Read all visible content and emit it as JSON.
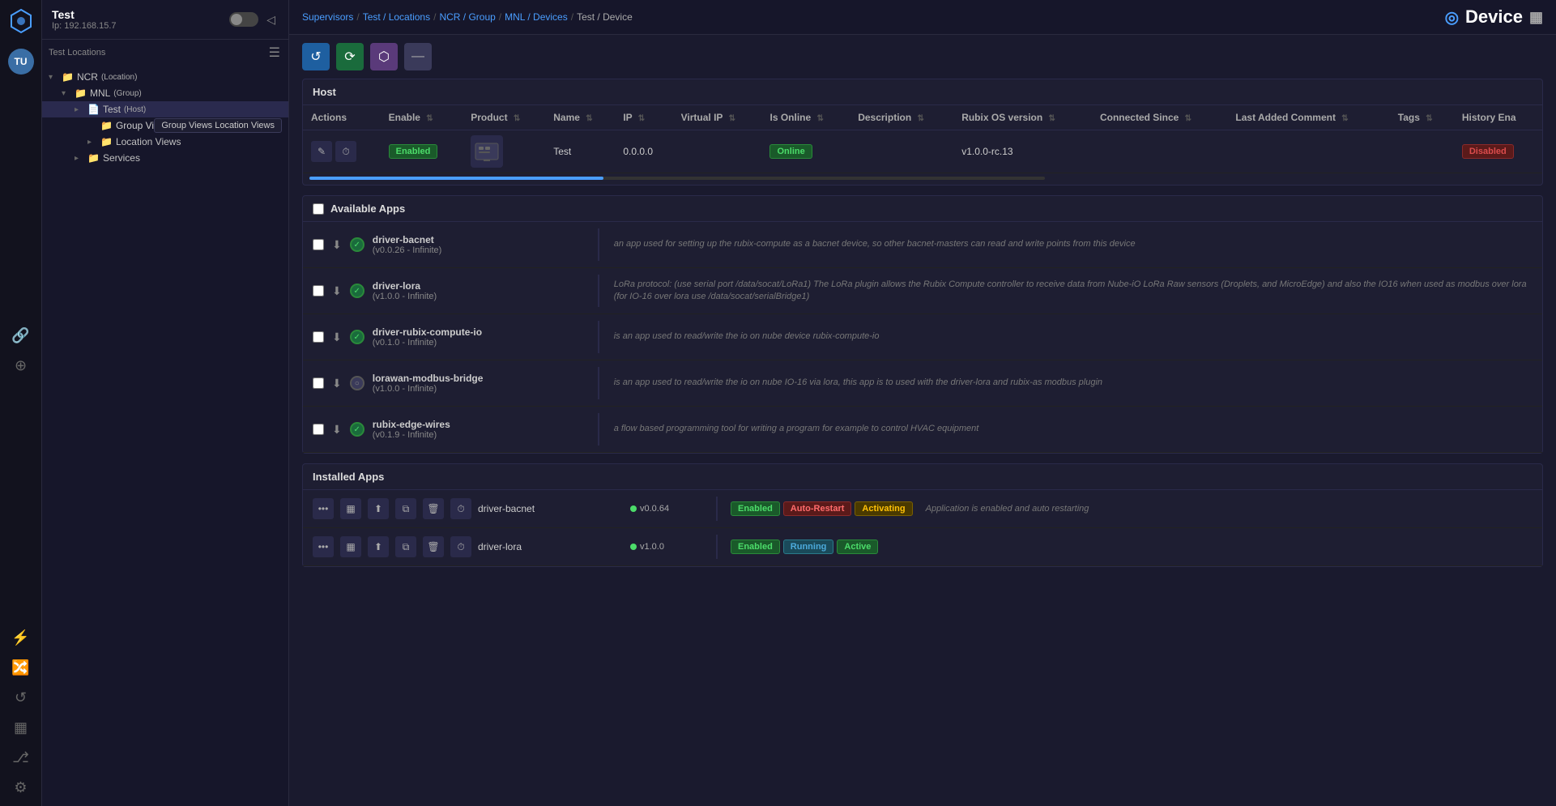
{
  "app": {
    "logo": "◈",
    "title": "Device"
  },
  "sidebar": {
    "host_name": "Test",
    "host_ip": "Ip: 192.168.15.7",
    "tree": [
      {
        "id": "ncr",
        "level": 1,
        "label": "NCR",
        "badge": "(Location)",
        "icon": "📁",
        "chevron": "▾",
        "expanded": true
      },
      {
        "id": "mnl",
        "level": 2,
        "label": "MNL",
        "badge": "(Group)",
        "icon": "📁",
        "chevron": "▾",
        "expanded": true
      },
      {
        "id": "test-host",
        "level": 3,
        "label": "Test",
        "badge": "(Host)",
        "icon": "📄",
        "chevron": "▸",
        "selected": true
      },
      {
        "id": "group-views",
        "level": 4,
        "label": "Group Views",
        "badge": "",
        "icon": "📁",
        "chevron": ""
      },
      {
        "id": "location-views",
        "level": 4,
        "label": "Location Views",
        "badge": "",
        "icon": "📁",
        "chevron": "▸"
      },
      {
        "id": "services",
        "level": 3,
        "label": "Services",
        "badge": "",
        "icon": "📁",
        "chevron": "▸"
      }
    ],
    "nav_icons": [
      "⚡",
      "🔗",
      "⊕",
      "⚙"
    ]
  },
  "breadcrumb": {
    "items": [
      "Supervisors",
      "Test / Locations",
      "NCR / Group",
      "MNL / Devices",
      "Test / Device"
    ],
    "separators": [
      "/",
      "/",
      "/",
      "/"
    ]
  },
  "topbar": {
    "page_title": "Device"
  },
  "toolbar": {
    "buttons": [
      {
        "id": "refresh",
        "icon": "↺",
        "color": "blue",
        "label": "Refresh"
      },
      {
        "id": "sync",
        "icon": "⟳",
        "color": "green",
        "label": "Sync"
      },
      {
        "id": "settings",
        "icon": "⬡",
        "color": "purple",
        "label": "Settings"
      },
      {
        "id": "more",
        "icon": "⊟",
        "color": "gray",
        "label": "More"
      }
    ]
  },
  "host_section": {
    "title": "Host",
    "columns": [
      "Actions",
      "Enable",
      "Product",
      "Name",
      "IP",
      "Virtual IP",
      "Is Online",
      "Description",
      "Rubix OS version",
      "Connected Since",
      "Last Added Comment",
      "Tags",
      "History Ena"
    ],
    "row": {
      "enable": "Enabled",
      "product_image": "device",
      "name": "Test",
      "ip": "0.0.0.0",
      "virtual_ip": "",
      "is_online": "Online",
      "description": "",
      "rubix_os_version": "v1.0.0-rc.13",
      "connected_since": "",
      "last_added_comment": "",
      "tags": "",
      "history_enabled": "Disabled"
    }
  },
  "available_apps": {
    "title": "Available Apps",
    "apps": [
      {
        "name": "driver-bacnet",
        "version": "v0.0.26 - Infinite",
        "status": "green",
        "description": "an app used for setting up the rubix-compute as a bacnet device, so other bacnet-masters can read and write points from this device"
      },
      {
        "name": "driver-lora",
        "version": "v1.0.0 - Infinite",
        "status": "green",
        "description": "LoRa protocol: (use serial port /data/socat/LoRa1) The LoRa plugin allows the Rubix Compute controller to receive data from Nube-iO LoRa Raw sensors (Droplets, and MicroEdge) and also the IO16 when used as modbus over lora (for IO-16 over lora use /data/socat/serialBridge1)"
      },
      {
        "name": "driver-rubix-compute-io",
        "version": "v0.1.0 - Infinite",
        "status": "green",
        "description": "is an app used to read/write the io on nube device rubix-compute-io"
      },
      {
        "name": "lorawan-modbus-bridge",
        "version": "v1.0.0 - Infinite",
        "status": "gray",
        "description": "is an app used to read/write the io on nube IO-16 via lora, this app is to used with the driver-lora and rubix-as modbus plugin"
      },
      {
        "name": "rubix-edge-wires",
        "version": "v0.1.9 - Infinite",
        "status": "green",
        "description": "a flow based programming tool for writing a program for example to control HVAC equipment"
      }
    ]
  },
  "installed_apps": {
    "title": "Installed Apps",
    "apps": [
      {
        "name": "driver-bacnet",
        "version": "v0.0.64",
        "version_color": "green",
        "badges": [
          "Enabled",
          "Auto-Restart",
          "Activating"
        ],
        "badge_types": [
          "enabled",
          "auto-restart",
          "activating"
        ],
        "description": "Application is enabled and auto restarting"
      },
      {
        "name": "driver-lora",
        "version": "v1.0.0",
        "version_color": "green",
        "badges": [
          "Enabled",
          "Running",
          "Active"
        ],
        "badge_types": [
          "enabled",
          "running",
          "active"
        ],
        "description": ""
      }
    ]
  },
  "icons": {
    "chevron_right": "▸",
    "chevron_down": "▾",
    "edit": "✎",
    "clock": "⏱",
    "download": "⬇",
    "dots": "•••",
    "table": "▦",
    "export": "⬆",
    "copy": "⧉",
    "trash": "🗑",
    "timer": "⏱"
  }
}
